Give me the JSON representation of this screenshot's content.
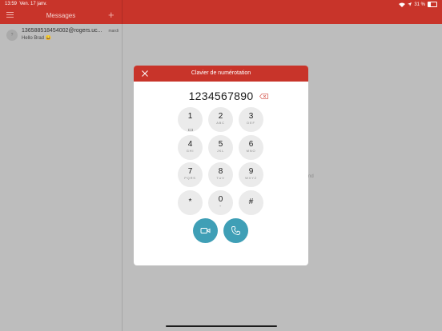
{
  "status": {
    "time": "13:59",
    "date": "Ven. 17 janv.",
    "battery": "31 %"
  },
  "nav": {
    "title": "Messages"
  },
  "conversation": {
    "avatar": "?",
    "name": "13658851845400​2@rogers.uc...",
    "date": "mardi",
    "preview": "Hello Brad 😀"
  },
  "background_text": "nd",
  "dialog": {
    "title": "Clavier de numérotation",
    "number": "1234567890",
    "keys": [
      {
        "digit": "1",
        "letters": ""
      },
      {
        "digit": "2",
        "letters": "ABC"
      },
      {
        "digit": "3",
        "letters": "DEF"
      },
      {
        "digit": "4",
        "letters": "GHI"
      },
      {
        "digit": "5",
        "letters": "JKL"
      },
      {
        "digit": "6",
        "letters": "MNO"
      },
      {
        "digit": "7",
        "letters": "PQRS"
      },
      {
        "digit": "8",
        "letters": "TUV"
      },
      {
        "digit": "9",
        "letters": "WXYZ"
      },
      {
        "digit": "*",
        "letters": ""
      },
      {
        "digit": "0",
        "letters": "+"
      },
      {
        "digit": "#",
        "letters": ""
      }
    ],
    "actions": [
      {
        "name": "video-call",
        "icon": "video-camera-icon"
      },
      {
        "name": "voice-call",
        "icon": "phone-icon"
      }
    ]
  },
  "colors": {
    "accent": "#c8342a",
    "call_button": "#3f9fb6",
    "key_bg": "#ebebeb"
  }
}
